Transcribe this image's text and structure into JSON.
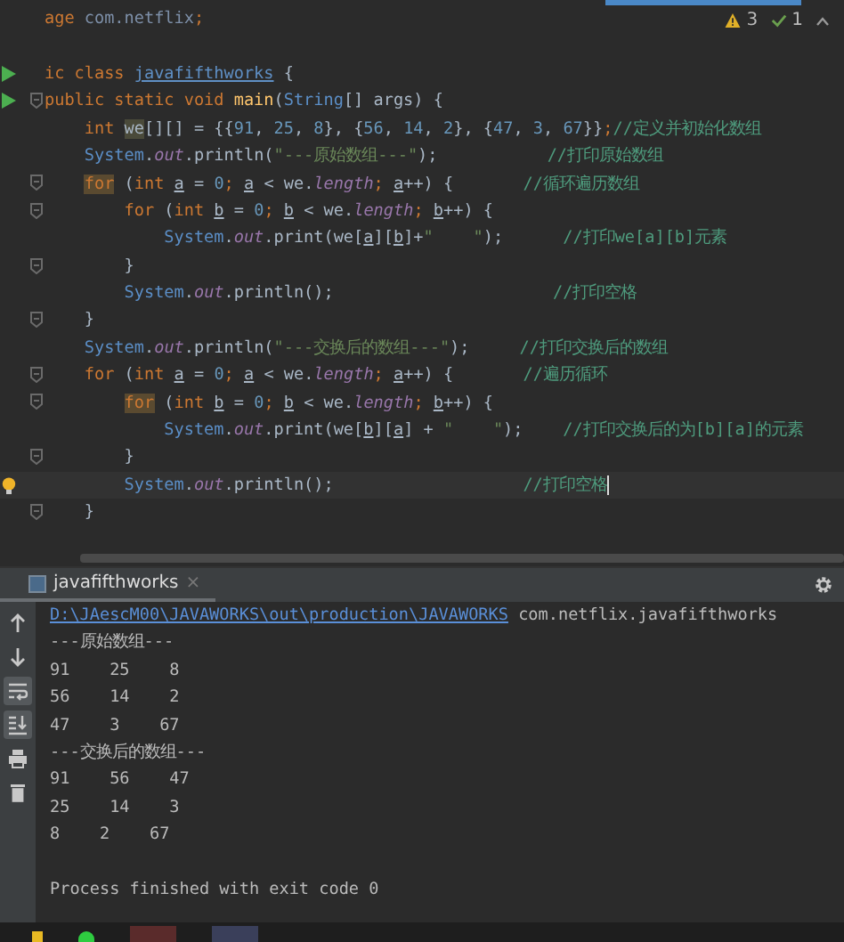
{
  "editor": {
    "inspections": {
      "warnings": "3",
      "weak_warnings": "1"
    },
    "lines": [
      {
        "tokens": [
          {
            "kind": "kw",
            "text": "age "
          },
          {
            "kind": "pkg",
            "text": "com.netflix"
          },
          {
            "kind": "kw",
            "text": ";"
          }
        ]
      },
      {
        "space_before": true,
        "run": true,
        "tokens": [
          {
            "kind": "kw",
            "text": "ic class "
          },
          {
            "kind": "link",
            "text": "javafifthworks"
          },
          {
            "kind": "plain",
            "text": " {"
          }
        ]
      },
      {
        "run": true,
        "fold": true,
        "tokens": [
          {
            "kind": "kw",
            "text": "public static void "
          },
          {
            "kind": "fn",
            "text": "main"
          },
          {
            "kind": "plain",
            "text": "("
          },
          {
            "kind": "cls",
            "text": "String"
          },
          {
            "kind": "plain",
            "text": "[] args) {"
          }
        ]
      },
      {
        "tokens": [
          {
            "kind": "kw",
            "text": "    int "
          },
          {
            "kind": "hl",
            "text": "we"
          },
          {
            "kind": "plain",
            "text": "[][] = {{"
          },
          {
            "kind": "num",
            "text": "91"
          },
          {
            "kind": "plain",
            "text": ", "
          },
          {
            "kind": "num",
            "text": "25"
          },
          {
            "kind": "plain",
            "text": ", "
          },
          {
            "kind": "num",
            "text": "8"
          },
          {
            "kind": "plain",
            "text": "}, {"
          },
          {
            "kind": "num",
            "text": "56"
          },
          {
            "kind": "plain",
            "text": ", "
          },
          {
            "kind": "num",
            "text": "14"
          },
          {
            "kind": "plain",
            "text": ", "
          },
          {
            "kind": "num",
            "text": "2"
          },
          {
            "kind": "plain",
            "text": "}, {"
          },
          {
            "kind": "num",
            "text": "47"
          },
          {
            "kind": "plain",
            "text": ", "
          },
          {
            "kind": "num",
            "text": "3"
          },
          {
            "kind": "plain",
            "text": ", "
          },
          {
            "kind": "num",
            "text": "67"
          },
          {
            "kind": "plain",
            "text": "}}"
          },
          {
            "kind": "kw",
            "text": ";"
          },
          {
            "kind": "cmt",
            "text": "//定义并初始化数组"
          }
        ]
      },
      {
        "tokens": [
          {
            "kind": "cls",
            "text": "    System"
          },
          {
            "kind": "plain",
            "text": "."
          },
          {
            "kind": "field",
            "text": "out"
          },
          {
            "kind": "plain",
            "text": ".println("
          },
          {
            "kind": "str",
            "text": "\"---原始数组---\""
          },
          {
            "kind": "plain",
            "text": ");           "
          },
          {
            "kind": "cmt",
            "text": "//打印原始数组"
          }
        ]
      },
      {
        "fold": true,
        "tokens": [
          {
            "kind": "hlkw",
            "text": "    for"
          },
          {
            "kind": "plain",
            "text": " ("
          },
          {
            "kind": "kw",
            "text": "int "
          },
          {
            "kind": "var",
            "text": "a"
          },
          {
            "kind": "plain",
            "text": " = "
          },
          {
            "kind": "num",
            "text": "0"
          },
          {
            "kind": "kw",
            "text": "; "
          },
          {
            "kind": "var",
            "text": "a"
          },
          {
            "kind": "plain",
            "text": " < we."
          },
          {
            "kind": "field",
            "text": "length"
          },
          {
            "kind": "kw",
            "text": "; "
          },
          {
            "kind": "var",
            "text": "a"
          },
          {
            "kind": "plain",
            "text": "++) {       "
          },
          {
            "kind": "cmt",
            "text": "//循环遍历数组"
          }
        ]
      },
      {
        "fold": true,
        "tokens": [
          {
            "kind": "kw",
            "text": "        for "
          },
          {
            "kind": "plain",
            "text": "("
          },
          {
            "kind": "kw",
            "text": "int "
          },
          {
            "kind": "var",
            "text": "b"
          },
          {
            "kind": "plain",
            "text": " = "
          },
          {
            "kind": "num",
            "text": "0"
          },
          {
            "kind": "kw",
            "text": "; "
          },
          {
            "kind": "var",
            "text": "b"
          },
          {
            "kind": "plain",
            "text": " < we."
          },
          {
            "kind": "field",
            "text": "length"
          },
          {
            "kind": "kw",
            "text": "; "
          },
          {
            "kind": "var",
            "text": "b"
          },
          {
            "kind": "plain",
            "text": "++) {"
          }
        ]
      },
      {
        "tokens": [
          {
            "kind": "cls",
            "text": "            System"
          },
          {
            "kind": "plain",
            "text": "."
          },
          {
            "kind": "field",
            "text": "out"
          },
          {
            "kind": "plain",
            "text": ".print(we["
          },
          {
            "kind": "var",
            "text": "a"
          },
          {
            "kind": "plain",
            "text": "]["
          },
          {
            "kind": "var",
            "text": "b"
          },
          {
            "kind": "plain",
            "text": "]+"
          },
          {
            "kind": "str",
            "text": "\"    \""
          },
          {
            "kind": "plain",
            "text": ");      "
          },
          {
            "kind": "cmt",
            "text": "//打印we[a][b]元素"
          }
        ]
      },
      {
        "fold": true,
        "tokens": [
          {
            "kind": "plain",
            "text": "        }"
          }
        ]
      },
      {
        "tokens": [
          {
            "kind": "cls",
            "text": "        System"
          },
          {
            "kind": "plain",
            "text": "."
          },
          {
            "kind": "field",
            "text": "out"
          },
          {
            "kind": "plain",
            "text": ".println();                      "
          },
          {
            "kind": "cmt",
            "text": "//打印空格"
          }
        ]
      },
      {
        "fold": true,
        "tokens": [
          {
            "kind": "plain",
            "text": "    }"
          }
        ]
      },
      {
        "tokens": [
          {
            "kind": "cls",
            "text": "    System"
          },
          {
            "kind": "plain",
            "text": "."
          },
          {
            "kind": "field",
            "text": "out"
          },
          {
            "kind": "plain",
            "text": ".println("
          },
          {
            "kind": "str",
            "text": "\"---交换后的数组---\""
          },
          {
            "kind": "plain",
            "text": ");     "
          },
          {
            "kind": "cmt",
            "text": "//打印交换后的数组"
          }
        ]
      },
      {
        "fold": true,
        "tokens": [
          {
            "kind": "kw",
            "text": "    for "
          },
          {
            "kind": "plain",
            "text": "("
          },
          {
            "kind": "kw",
            "text": "int "
          },
          {
            "kind": "var",
            "text": "a"
          },
          {
            "kind": "plain",
            "text": " = "
          },
          {
            "kind": "num",
            "text": "0"
          },
          {
            "kind": "kw",
            "text": "; "
          },
          {
            "kind": "var",
            "text": "a"
          },
          {
            "kind": "plain",
            "text": " < we."
          },
          {
            "kind": "field",
            "text": "length"
          },
          {
            "kind": "kw",
            "text": "; "
          },
          {
            "kind": "var",
            "text": "a"
          },
          {
            "kind": "plain",
            "text": "++) {       "
          },
          {
            "kind": "cmt",
            "text": "//遍历循环"
          }
        ]
      },
      {
        "fold": true,
        "tokens": [
          {
            "kind": "hlkw",
            "text": "        for"
          },
          {
            "kind": "plain",
            "text": " ("
          },
          {
            "kind": "kw",
            "text": "int "
          },
          {
            "kind": "var",
            "text": "b"
          },
          {
            "kind": "plain",
            "text": " = "
          },
          {
            "kind": "num",
            "text": "0"
          },
          {
            "kind": "kw",
            "text": "; "
          },
          {
            "kind": "var",
            "text": "b"
          },
          {
            "kind": "plain",
            "text": " < we."
          },
          {
            "kind": "field",
            "text": "length"
          },
          {
            "kind": "kw",
            "text": "; "
          },
          {
            "kind": "var",
            "text": "b"
          },
          {
            "kind": "plain",
            "text": "++) {"
          }
        ]
      },
      {
        "tokens": [
          {
            "kind": "cls",
            "text": "            System"
          },
          {
            "kind": "plain",
            "text": "."
          },
          {
            "kind": "field",
            "text": "out"
          },
          {
            "kind": "plain",
            "text": ".print(we["
          },
          {
            "kind": "var",
            "text": "b"
          },
          {
            "kind": "plain",
            "text": "]["
          },
          {
            "kind": "var",
            "text": "a"
          },
          {
            "kind": "plain",
            "text": "] + "
          },
          {
            "kind": "str",
            "text": "\"    \""
          },
          {
            "kind": "plain",
            "text": ");    "
          },
          {
            "kind": "cmt",
            "text": "//打印交换后的为[b][a]的元素"
          }
        ]
      },
      {
        "fold": true,
        "tokens": [
          {
            "kind": "plain",
            "text": "        }"
          }
        ]
      },
      {
        "bulb": true,
        "current": true,
        "tokens": [
          {
            "kind": "cls",
            "text": "        System"
          },
          {
            "kind": "plain",
            "text": "."
          },
          {
            "kind": "field",
            "text": "out"
          },
          {
            "kind": "plain",
            "text": ".println();                   "
          },
          {
            "kind": "cmt",
            "text": "//打印空格"
          }
        ]
      },
      {
        "fold": true,
        "tokens": [
          {
            "kind": "plain",
            "text": "    }"
          }
        ]
      }
    ]
  },
  "console": {
    "tab": {
      "title": "javafifthworks",
      "close": "×",
      "selected": true
    },
    "tools": [
      {
        "kind": "up",
        "on": false
      },
      {
        "kind": "down",
        "on": false
      },
      {
        "kind": "wrap",
        "on": true
      },
      {
        "kind": "scroll-end",
        "on": true
      },
      {
        "kind": "print",
        "on": false
      },
      {
        "kind": "trash",
        "on": false
      }
    ],
    "command": {
      "path": "D:\\JAescM00\\JAVAWORKS\\out\\production\\JAVAWORKS",
      "text": " com.netflix.javafifthworks"
    },
    "output": [
      "---原始数组---",
      "91    25    8",
      "56    14    2",
      "47    3    67",
      "---交换后的数组---",
      "91    56    47",
      "25    14    3",
      "8    2    67"
    ],
    "exit_message": "Process finished with exit code 0"
  }
}
